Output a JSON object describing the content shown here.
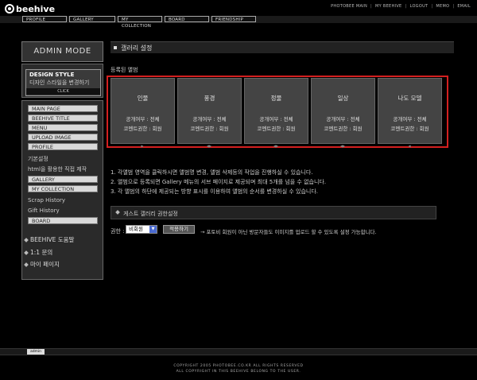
{
  "header": {
    "logo_text": "beehive",
    "top_links": [
      "PHOTOBEE MAIN",
      "MY BEEHIVE",
      "LOGOUT",
      "MEMO",
      "EMAIL"
    ],
    "nav_tabs": [
      "PROFILE",
      "GALLERY",
      "MY COLLECTION",
      "BOARD",
      "FRIENDSHIP"
    ]
  },
  "sidebar": {
    "admin_mode": "ADMIN MODE",
    "design_style": {
      "title": "DESIGN STYLE",
      "subtitle": "디자인 스타일을 변경하기",
      "click": "CLICK"
    },
    "menu": {
      "main_page": "MAIN PAGE",
      "beehive_title": "BEEHIVE TITLE",
      "menu": "MENU",
      "upload_image": "UPLOAD IMAGE",
      "profile": "PROFILE",
      "profile_sub1": "기본설정",
      "profile_sub2": "html을 활용한 직접 제작",
      "gallery": "GALLERY",
      "my_collection": "MY COLLECTION",
      "collection_sub1": "Scrap History",
      "collection_sub2": "Gift History",
      "board": "BOARD"
    },
    "help_links": [
      "BEEHIVE 도움말",
      "1:1 문의",
      "마이 페이지"
    ]
  },
  "main": {
    "section_title": "갤러리 설정",
    "albums_label": "등록된 앨범",
    "albums": [
      {
        "name": "인물",
        "visibility": "공개여부 : 전체",
        "comment": "코멘트권한 : 회원"
      },
      {
        "name": "풍경",
        "visibility": "공개여부 : 전체",
        "comment": "코멘트권한 : 회원"
      },
      {
        "name": "정물",
        "visibility": "공개여부 : 전체",
        "comment": "코멘트권한 : 회원"
      },
      {
        "name": "일상",
        "visibility": "공개여부 : 전체",
        "comment": "코멘트권한 : 회원"
      },
      {
        "name": "나도 모델",
        "visibility": "공개여부 : 전체",
        "comment": "코멘트권한 : 회원"
      }
    ],
    "notes": [
      "1. 각앨범 영역을 클릭하시면 앨범명 변경, 앨범 삭제등의 작업을 진행하실 수 있습니다.",
      "2. 앨범으로 등록되면 Gallery 메뉴의 서브 페이지로 제공되며 최대 5개를 넘을 수 없습니다.",
      "3. 각 앨범의 하단에 제공되는 방향 표시를 이용하여 앨범의 순서를 변경하실 수 있습니다."
    ],
    "guest_section_title": "게스트 갤러리 권한설정",
    "permission_label": "권한 :",
    "permission_value": "비회원",
    "apply_button": "적용하기",
    "permission_desc": "→ 포토비 회원이 아닌 방문자들도 이미지를 업로드 할 수 있도록 설정 가능합니다."
  },
  "footer": {
    "admin_label": "admin",
    "copyright_1": "COPYRIGHT 2005 PHOTOBEE.CO.KR ALL RIGHTS RESERVED",
    "copyright_2": "ALL COPYRIGHT IN THIS BEEHIVE BELONG TO THE USER."
  },
  "colors": {
    "background": "#000000",
    "highlight_frame": "#d42020",
    "album_card": "#444444",
    "menu_button": "#d9d9d9"
  }
}
